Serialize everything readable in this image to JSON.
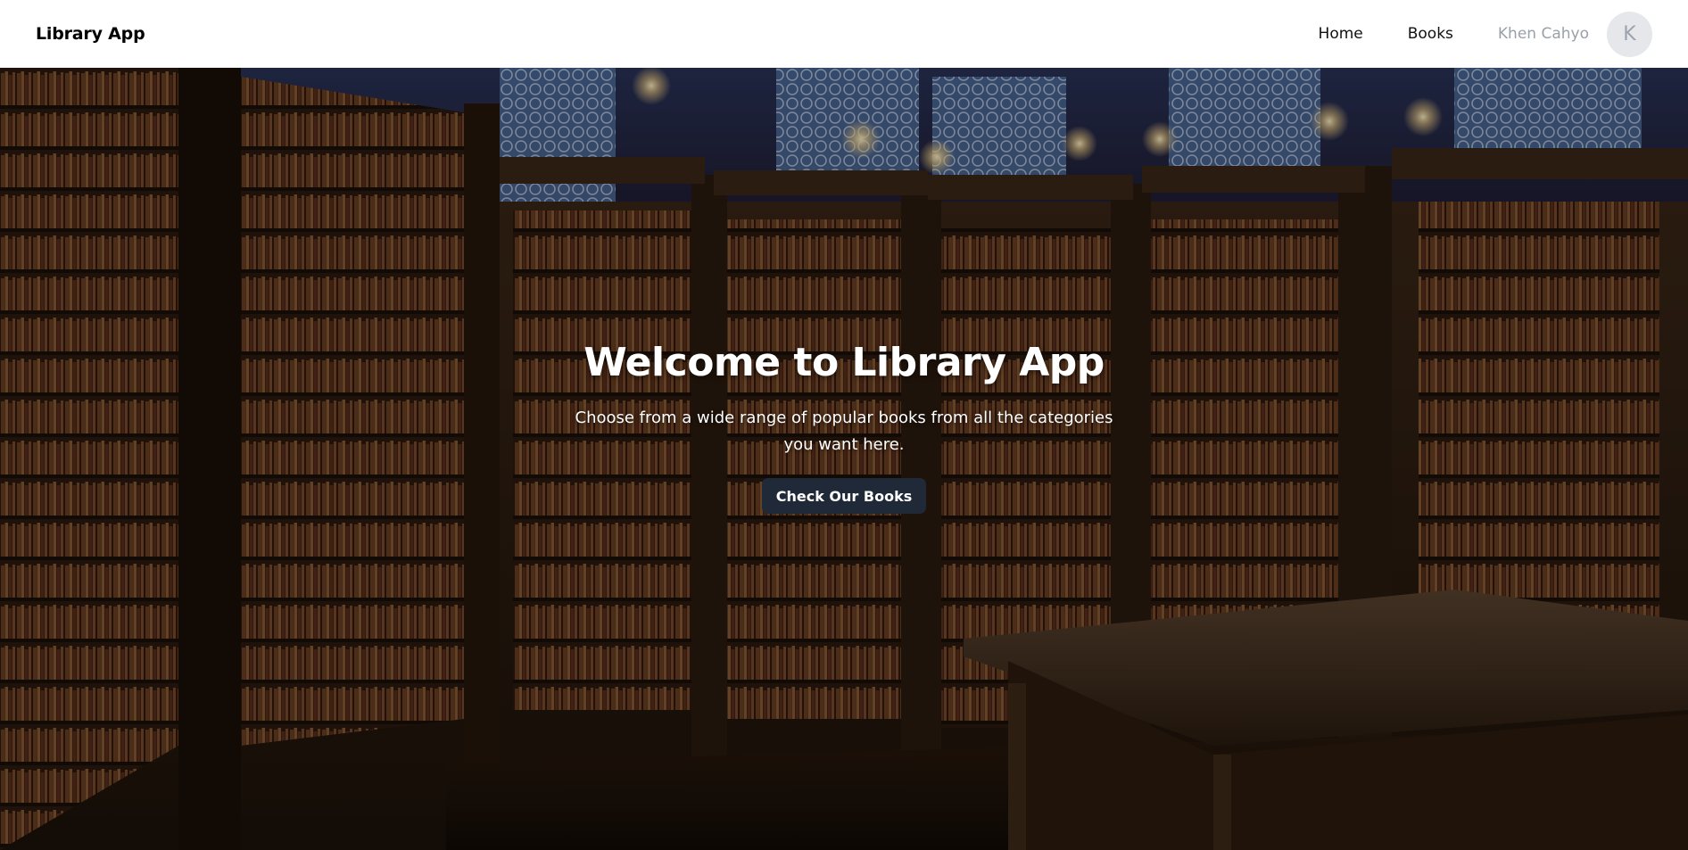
{
  "navbar": {
    "brand": "Library App",
    "links": [
      {
        "label": "Home"
      },
      {
        "label": "Books"
      }
    ],
    "user_name": "Khen Cahyo",
    "avatar_initial": "K"
  },
  "hero": {
    "title": "Welcome to Library App",
    "subtitle": "Choose from a wide range of popular books from all the categories you want here.",
    "cta_label": "Check Our Books"
  },
  "colors": {
    "button_bg": "#1f2937",
    "avatar_bg": "#e5e7eb",
    "user_text": "#9aa0a8"
  }
}
